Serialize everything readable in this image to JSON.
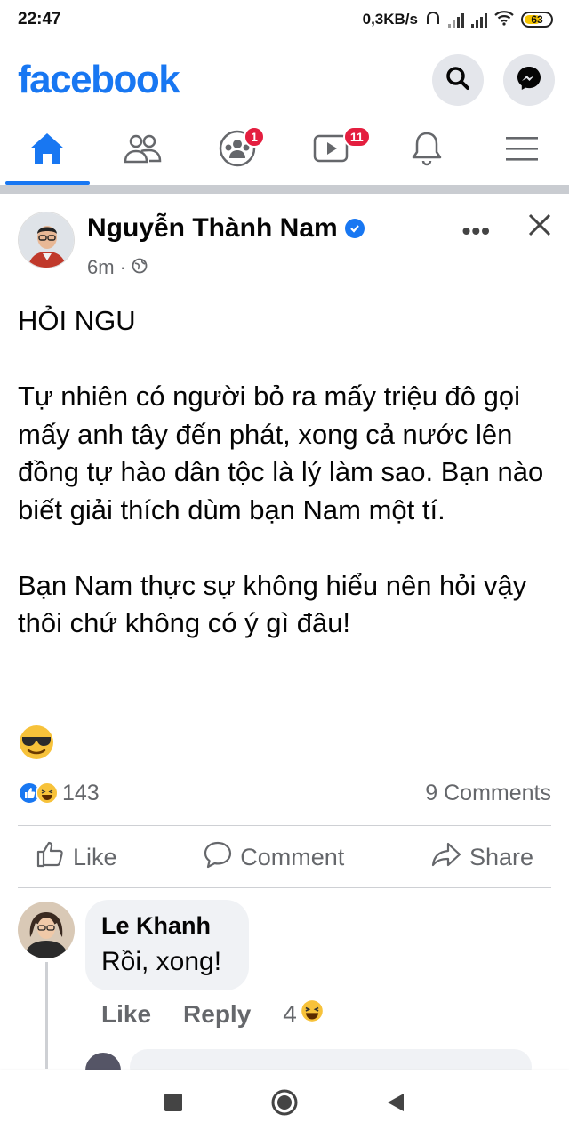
{
  "status_bar": {
    "time": "22:47",
    "net_speed": "0,3KB/s",
    "battery": "63"
  },
  "header": {
    "logo": "facebook"
  },
  "tabs": {
    "groups_badge": "1",
    "watch_badge": "11"
  },
  "post": {
    "author": "Nguyễn Thành Nam",
    "time": "6m",
    "paragraphs": [
      "HỎI NGU",
      "Tự nhiên có người bỏ ra mấy triệu đô gọi mấy anh tây đến phát, xong cả nước lên đồng tự hào dân tộc là lý làm sao. Bạn nào biết giải thích dùm bạn Nam một tí.",
      "Bạn Nam thực sự không hiểu nên hỏi vậy thôi chứ không có ý gì đâu!"
    ],
    "reaction_count": "143",
    "comments_count": "9 Comments"
  },
  "actions": {
    "like": "Like",
    "comment": "Comment",
    "share": "Share"
  },
  "comment": {
    "author": "Le Khanh",
    "text": "Rồi, xong!",
    "like": "Like",
    "reply": "Reply",
    "reaction_count": "4"
  },
  "colors": {
    "brand": "#1877f2",
    "badge": "#e41e3f",
    "muted": "#65676b"
  }
}
